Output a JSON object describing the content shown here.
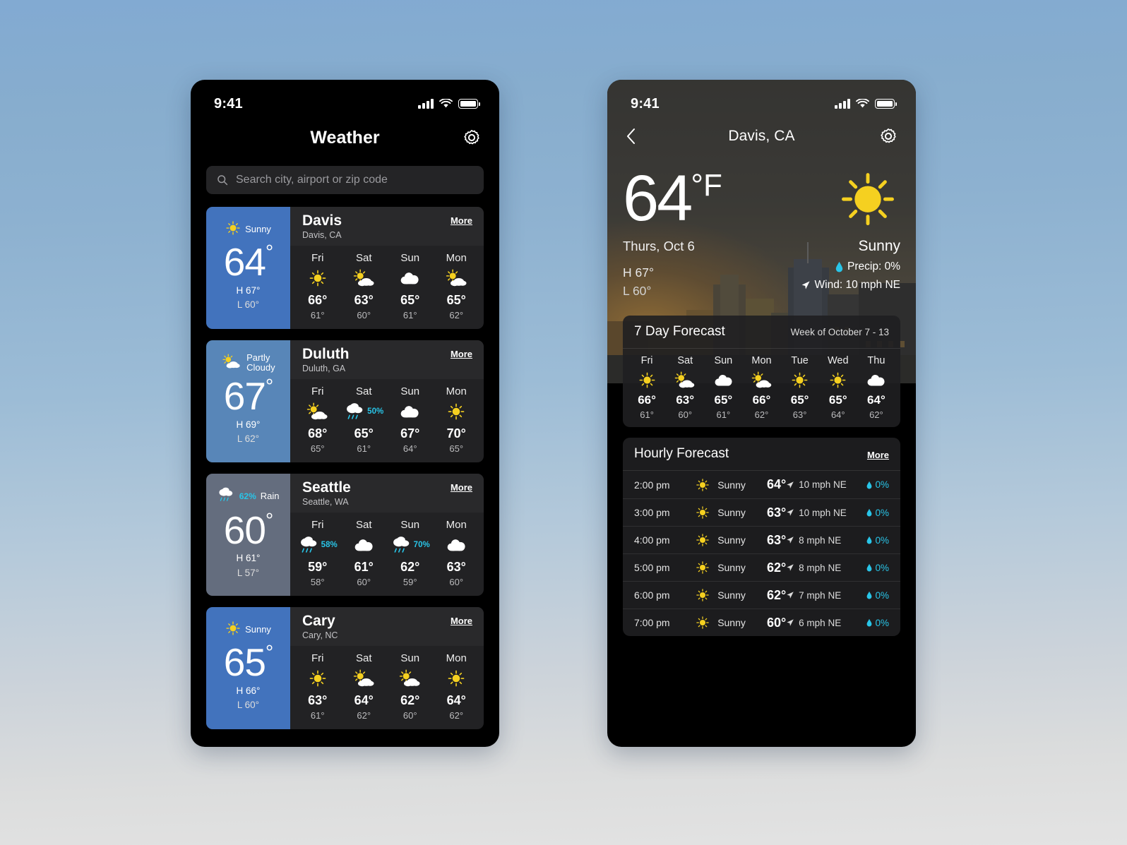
{
  "status_bar": {
    "time": "9:41",
    "signal_icon": "cellular-signal-icon",
    "wifi_icon": "wifi-icon",
    "battery_icon": "battery-icon"
  },
  "left_screen": {
    "title": "Weather",
    "settings_icon": "gear-icon",
    "search": {
      "icon": "search-icon",
      "placeholder": "Search city, airport or zip code",
      "value": ""
    },
    "more_label": "More",
    "cards": [
      {
        "name": "Davis",
        "region": "Davis, CA",
        "condition": "Sunny",
        "condition_icon": "sun-icon",
        "precip_pct": "",
        "temp": "64",
        "high": "H 67°",
        "low": "L 60°",
        "tile_color": "#4273bd",
        "days": [
          {
            "name": "Fri",
            "icon": "sun-icon",
            "pct": "",
            "hi": "66°",
            "lo": "61°"
          },
          {
            "name": "Sat",
            "icon": "sun-cloud-icon",
            "pct": "",
            "hi": "63°",
            "lo": "60°"
          },
          {
            "name": "Sun",
            "icon": "cloud-icon",
            "pct": "",
            "hi": "65°",
            "lo": "61°"
          },
          {
            "name": "Mon",
            "icon": "sun-cloud-icon",
            "pct": "",
            "hi": "65°",
            "lo": "62°"
          }
        ]
      },
      {
        "name": "Duluth",
        "region": "Duluth, GA",
        "condition": "Partly Cloudy",
        "condition_icon": "sun-cloud-icon",
        "precip_pct": "",
        "temp": "67",
        "high": "H 69°",
        "low": "L 62°",
        "tile_color": "#5886b8",
        "days": [
          {
            "name": "Fri",
            "icon": "sun-cloud-icon",
            "pct": "",
            "hi": "68°",
            "lo": "65°"
          },
          {
            "name": "Sat",
            "icon": "rain-icon",
            "pct": "50%",
            "hi": "65°",
            "lo": "61°"
          },
          {
            "name": "Sun",
            "icon": "cloud-icon",
            "pct": "",
            "hi": "67°",
            "lo": "64°"
          },
          {
            "name": "Mon",
            "icon": "sun-icon",
            "pct": "",
            "hi": "70°",
            "lo": "65°"
          }
        ]
      },
      {
        "name": "Seattle",
        "region": "Seattle, WA",
        "condition": "Rain",
        "condition_icon": "rain-icon",
        "precip_pct": "62%",
        "temp": "60",
        "high": "H 61°",
        "low": "L 57°",
        "tile_color": "#646d7e",
        "days": [
          {
            "name": "Fri",
            "icon": "rain-icon",
            "pct": "58%",
            "hi": "59°",
            "lo": "58°"
          },
          {
            "name": "Sat",
            "icon": "cloud-icon",
            "pct": "",
            "hi": "61°",
            "lo": "60°"
          },
          {
            "name": "Sun",
            "icon": "rain-icon",
            "pct": "70%",
            "hi": "62°",
            "lo": "59°"
          },
          {
            "name": "Mon",
            "icon": "cloud-icon",
            "pct": "",
            "hi": "63°",
            "lo": "60°"
          }
        ]
      },
      {
        "name": "Cary",
        "region": "Cary, NC",
        "condition": "Sunny",
        "condition_icon": "sun-icon",
        "precip_pct": "",
        "temp": "65",
        "high": "H 66°",
        "low": "L 60°",
        "tile_color": "#4273bd",
        "days": [
          {
            "name": "Fri",
            "icon": "sun-icon",
            "pct": "",
            "hi": "63°",
            "lo": "61°"
          },
          {
            "name": "Sat",
            "icon": "sun-cloud-icon",
            "pct": "",
            "hi": "64°",
            "lo": "62°"
          },
          {
            "name": "Sun",
            "icon": "sun-cloud-icon",
            "pct": "",
            "hi": "62°",
            "lo": "60°"
          },
          {
            "name": "Mon",
            "icon": "sun-icon",
            "pct": "",
            "hi": "64°",
            "lo": "62°"
          }
        ]
      }
    ]
  },
  "right_screen": {
    "title": "Davis, CA",
    "back_icon": "chevron-left-icon",
    "settings_icon": "gear-icon",
    "current": {
      "temp": "64",
      "unit": "°F",
      "date": "Thurs, Oct 6",
      "high": "H 67°",
      "low": "L 60°",
      "condition": "Sunny",
      "condition_icon": "sun-icon",
      "precip": "Precip: 0%",
      "precip_icon": "droplet-icon",
      "wind": "Wind: 10 mph NE",
      "wind_icon": "wind-arrow-icon"
    },
    "week_panel": {
      "title": "7 Day Forecast",
      "subtitle": "Week of October 7 - 13",
      "days": [
        {
          "name": "Fri",
          "icon": "sun-icon",
          "hi": "66°",
          "lo": "61°"
        },
        {
          "name": "Sat",
          "icon": "sun-cloud-icon",
          "hi": "63°",
          "lo": "60°"
        },
        {
          "name": "Sun",
          "icon": "cloud-icon",
          "hi": "65°",
          "lo": "61°"
        },
        {
          "name": "Mon",
          "icon": "sun-cloud-icon",
          "hi": "66°",
          "lo": "62°"
        },
        {
          "name": "Tue",
          "icon": "sun-icon",
          "hi": "65°",
          "lo": "63°"
        },
        {
          "name": "Wed",
          "icon": "sun-icon",
          "hi": "65°",
          "lo": "64°"
        },
        {
          "name": "Thu",
          "icon": "cloud-icon",
          "hi": "64°",
          "lo": "62°"
        }
      ]
    },
    "hourly_panel": {
      "title": "Hourly Forecast",
      "more_label": "More",
      "rows": [
        {
          "time": "2:00 pm",
          "icon": "sun-icon",
          "condition": "Sunny",
          "temp": "64°",
          "wind": "10 mph NE",
          "precip": "0%"
        },
        {
          "time": "3:00 pm",
          "icon": "sun-icon",
          "condition": "Sunny",
          "temp": "63°",
          "wind": "10 mph NE",
          "precip": "0%"
        },
        {
          "time": "4:00 pm",
          "icon": "sun-icon",
          "condition": "Sunny",
          "temp": "63°",
          "wind": "8 mph NE",
          "precip": "0%"
        },
        {
          "time": "5:00 pm",
          "icon": "sun-icon",
          "condition": "Sunny",
          "temp": "62°",
          "wind": "8 mph NE",
          "precip": "0%"
        },
        {
          "time": "6:00 pm",
          "icon": "sun-icon",
          "condition": "Sunny",
          "temp": "62°",
          "wind": "7 mph NE",
          "precip": "0%"
        },
        {
          "time": "7:00 pm",
          "icon": "sun-icon",
          "condition": "Sunny",
          "temp": "60°",
          "wind": "6 mph NE",
          "precip": "0%"
        }
      ]
    }
  },
  "colors": {
    "accent_blue": "#4273bd",
    "cyan": "#29c5e8",
    "sun_yellow": "#f5d020",
    "card_bg": "#222224"
  }
}
